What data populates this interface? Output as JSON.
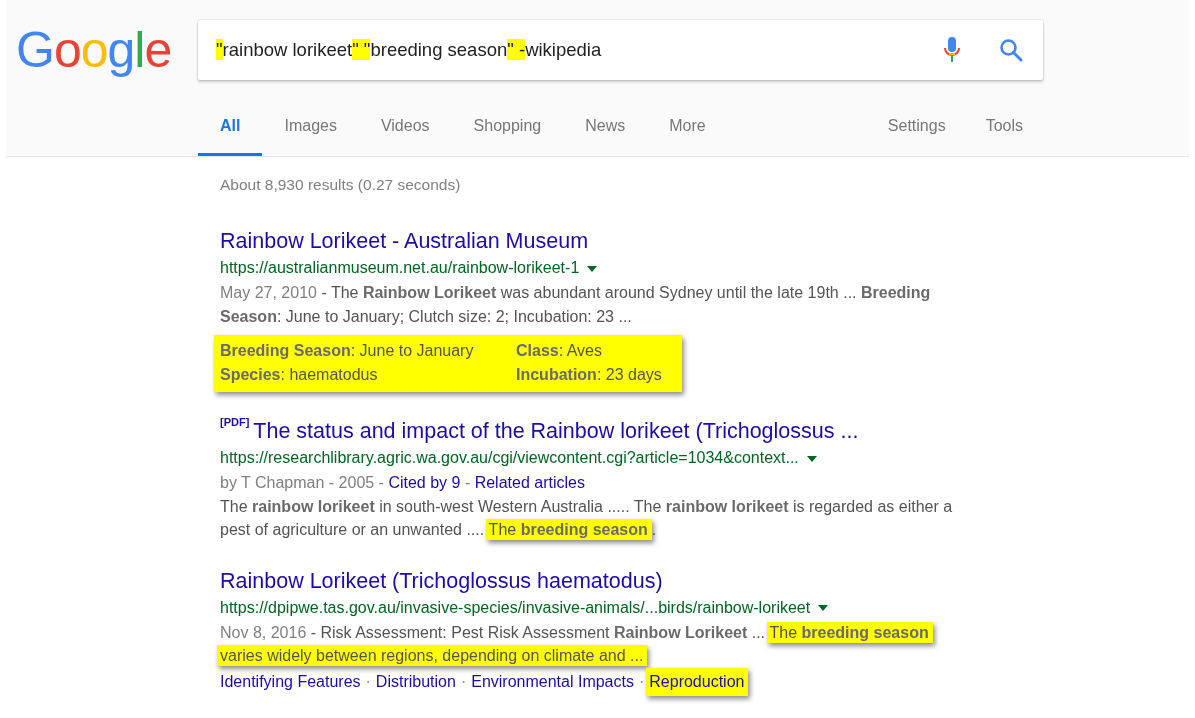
{
  "logo": {
    "letters": [
      {
        "text": "G",
        "color": "#4285f4"
      },
      {
        "text": "o",
        "color": "#ea4335"
      },
      {
        "text": "o",
        "color": "#fbbc05"
      },
      {
        "text": "g",
        "color": "#4285f4"
      },
      {
        "text": "l",
        "color": "#34a853"
      },
      {
        "text": "e",
        "color": "#ea4335"
      }
    ]
  },
  "search": {
    "query": [
      {
        "text": "\"",
        "highlighted": true
      },
      {
        "text": "rainbow lorikeet",
        "highlighted": false
      },
      {
        "text": "\" \"",
        "highlighted": true
      },
      {
        "text": "breeding season",
        "highlighted": false
      },
      {
        "text": "\" -",
        "highlighted": true
      },
      {
        "text": "wikipedia",
        "highlighted": false
      }
    ]
  },
  "tabs": [
    {
      "label": "All",
      "selected": true
    },
    {
      "label": "Images",
      "selected": false
    },
    {
      "label": "Videos",
      "selected": false
    },
    {
      "label": "Shopping",
      "selected": false
    },
    {
      "label": "News",
      "selected": false
    },
    {
      "label": "More",
      "selected": false
    }
  ],
  "tools": [
    "Settings",
    "Tools"
  ],
  "result_stats": "About 8,930 results (0.27 seconds)",
  "results": [
    {
      "title": "Rainbow Lorikeet - Australian Museum",
      "url": "https://australianmuseum.net.au/rainbow-lorikeet-1",
      "snippet": [
        [
          {
            "kind": "date",
            "text": "May 27, 2010",
            "highlighted": false
          },
          {
            "kind": "text",
            "text": " - The **Rainbow Lorikeet** was abundant around Sydney until the late 19th ... **Breeding**",
            "highlighted": false
          }
        ],
        [
          {
            "kind": "text",
            "text": "**Season**: June to January; Clutch size: 2; Incubation: 23 ...",
            "highlighted": false
          }
        ]
      ],
      "facts": {
        "highlighted": true,
        "items": [
          {
            "label": "Breeding Season",
            "value": ": June to January"
          },
          {
            "label": "Class",
            "value": ": Aves"
          },
          {
            "label": "Species",
            "value": ": haematodus"
          },
          {
            "label": "Incubation",
            "value": ": 23 days"
          }
        ]
      }
    },
    {
      "badge": "[PDF]",
      "title": "The status and impact of the Rainbow lorikeet (Trichoglossus ...",
      "url": "https://researchlibrary.agric.wa.gov.au/cgi/viewcontent.cgi?article=1034&context...",
      "meta": [
        {
          "kind": "text",
          "text": "by T Chapman - 2005 - "
        },
        {
          "kind": "link",
          "text": "Cited by 9"
        },
        {
          "kind": "text",
          "text": " - "
        },
        {
          "kind": "link",
          "text": "Related articles"
        }
      ],
      "snippet": [
        [
          {
            "kind": "text",
            "text": "The **rainbow lorikeet** in south-west Western Australia ..... The **rainbow lorikeet** is regarded as either a",
            "highlighted": false
          }
        ],
        [
          {
            "kind": "text",
            "text": "pest of agriculture or an unwanted .... ",
            "highlighted": false
          },
          {
            "kind": "text",
            "text": "The **breeding season**",
            "highlighted": true
          },
          {
            "kind": "text",
            "text": ".",
            "highlighted": false
          }
        ]
      ]
    },
    {
      "title": "Rainbow Lorikeet (Trichoglossus haematodus)",
      "url": "https://dpipwe.tas.gov.au/invasive-species/invasive-animals/...birds/rainbow-lorikeet",
      "snippet": [
        [
          {
            "kind": "date",
            "text": "Nov 8, 2016",
            "highlighted": false
          },
          {
            "kind": "text",
            "text": " - Risk Assessment: Pest Risk Assessment **Rainbow Lorikeet** ... ",
            "highlighted": false
          },
          {
            "kind": "text",
            "text": "The **breeding season**",
            "highlighted": true
          }
        ],
        [
          {
            "kind": "text",
            "text": "varies widely between regions, depending on climate and ...",
            "highlighted": true
          }
        ]
      ],
      "sitelinks": {
        "separator": "·",
        "items": [
          {
            "label": "Identifying Features",
            "highlighted": false
          },
          {
            "label": "Distribution",
            "highlighted": false
          },
          {
            "label": "Environmental Impacts",
            "highlighted": false
          },
          {
            "label": "Reproduction",
            "highlighted": true
          }
        ]
      }
    }
  ]
}
